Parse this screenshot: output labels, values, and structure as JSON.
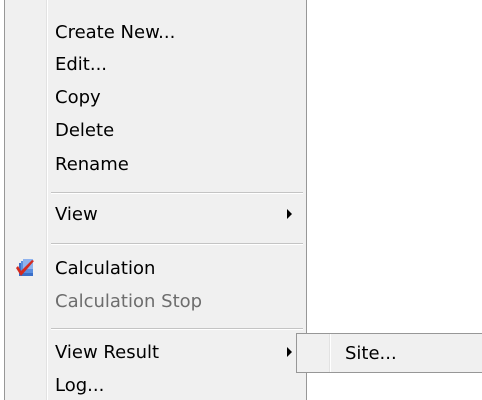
{
  "menu": {
    "items": [
      {
        "label": "Create New...",
        "disabled": false
      },
      {
        "label": "Edit...",
        "disabled": false
      },
      {
        "label": "Copy",
        "disabled": false
      },
      {
        "label": "Delete",
        "disabled": false
      },
      {
        "label": "Rename",
        "disabled": false
      },
      {
        "label": "View",
        "disabled": false,
        "submenu": true
      },
      {
        "label": "Calculation",
        "disabled": false,
        "icon": "calculation-icon"
      },
      {
        "label": "Calculation Stop",
        "disabled": true
      },
      {
        "label": "View Result",
        "disabled": false,
        "submenu": true,
        "expanded": true
      },
      {
        "label": "Log...",
        "disabled": false
      }
    ]
  },
  "submenu": {
    "items": [
      {
        "label": "Site..."
      }
    ]
  }
}
